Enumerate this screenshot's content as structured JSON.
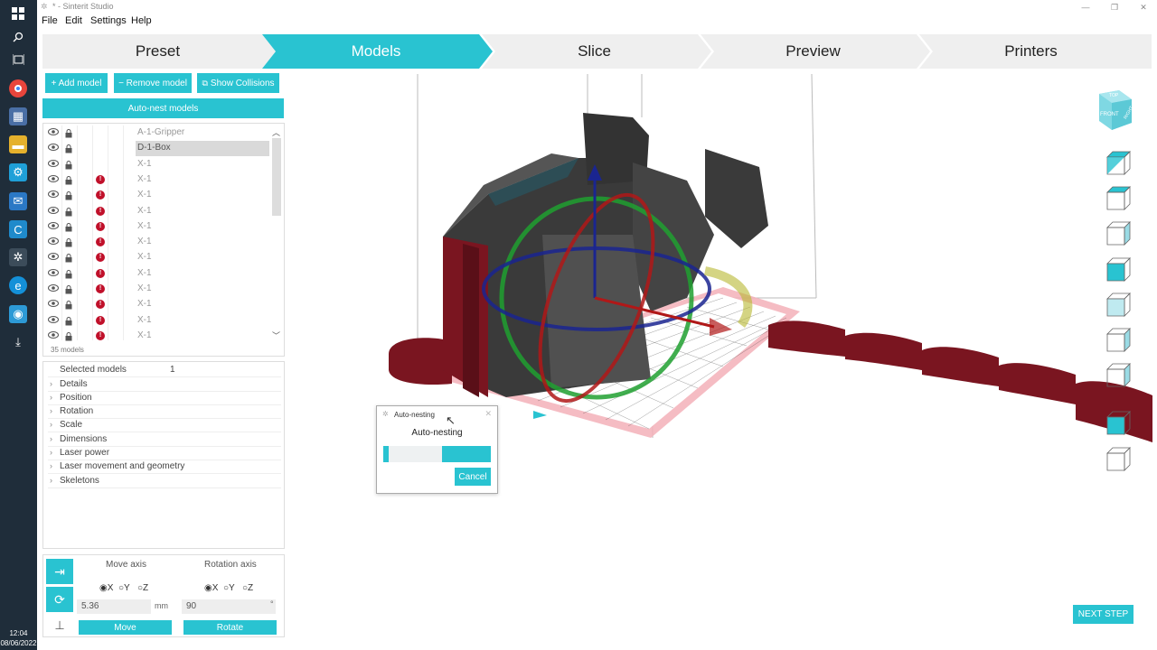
{
  "window": {
    "title": "* - Sinterit Studio"
  },
  "menu": [
    "File",
    "Edit",
    "Settings",
    "Help"
  ],
  "steps": [
    {
      "label": "Preset",
      "active": false
    },
    {
      "label": "Models",
      "active": true
    },
    {
      "label": "Slice",
      "active": false
    },
    {
      "label": "Preview",
      "active": false
    },
    {
      "label": "Printers",
      "active": false
    }
  ],
  "toolbar": {
    "add_model": "+ Add model",
    "remove_model": "− Remove model",
    "show_collisions": "Show Collisions",
    "auto_nest": "Auto-nest models"
  },
  "models": {
    "count_label": "35 models",
    "items": [
      {
        "name": "A-1-Gripper",
        "warning": false,
        "selected": false
      },
      {
        "name": "D-1-Box",
        "warning": false,
        "selected": true
      },
      {
        "name": "X-1",
        "warning": false,
        "selected": false
      },
      {
        "name": "X-1",
        "warning": true,
        "selected": false
      },
      {
        "name": "X-1",
        "warning": true,
        "selected": false
      },
      {
        "name": "X-1",
        "warning": true,
        "selected": false
      },
      {
        "name": "X-1",
        "warning": true,
        "selected": false
      },
      {
        "name": "X-1",
        "warning": true,
        "selected": false
      },
      {
        "name": "X-1",
        "warning": true,
        "selected": false
      },
      {
        "name": "X-1",
        "warning": true,
        "selected": false
      },
      {
        "name": "X-1",
        "warning": true,
        "selected": false
      },
      {
        "name": "X-1",
        "warning": true,
        "selected": false
      },
      {
        "name": "X-1",
        "warning": true,
        "selected": false
      },
      {
        "name": "X-1",
        "warning": true,
        "selected": false
      }
    ]
  },
  "properties": {
    "selected_label": "Selected models",
    "selected_value": "1",
    "sections": [
      "Details",
      "Position",
      "Rotation",
      "Scale",
      "Dimensions",
      "Laser power",
      "Laser movement and geometry",
      "Skeletons"
    ]
  },
  "transform": {
    "move_axis_label": "Move axis",
    "rotation_axis_label": "Rotation axis",
    "move_options": [
      "X",
      "Y",
      "Z"
    ],
    "move_selected": "X",
    "rotation_options": [
      "X",
      "Y",
      "Z"
    ],
    "rotation_selected": "X",
    "move_value": "5.36",
    "move_unit": "mm",
    "rotation_value": "90",
    "rotation_unit": "°",
    "move_button": "Move",
    "rotate_button": "Rotate"
  },
  "view_cube": {
    "front_label": "FRONT",
    "top_label": "TOP",
    "right_label": "RIGHT"
  },
  "dialog": {
    "title": "Auto-nesting",
    "heading": "Auto-nesting",
    "cancel": "Cancel",
    "progress_segments": [
      [
        0.0,
        0.05
      ],
      [
        0.55,
        1.0
      ]
    ]
  },
  "next_step": "NEXT STEP",
  "clock": {
    "time": "12:04",
    "date": "08/06/2022"
  },
  "colors": {
    "accent": "#29c3d1",
    "model_dark": "#3a3a3a",
    "model_red": "#7a1520",
    "bed_grid": "#f0a0a8",
    "warning": "#c0102a"
  }
}
